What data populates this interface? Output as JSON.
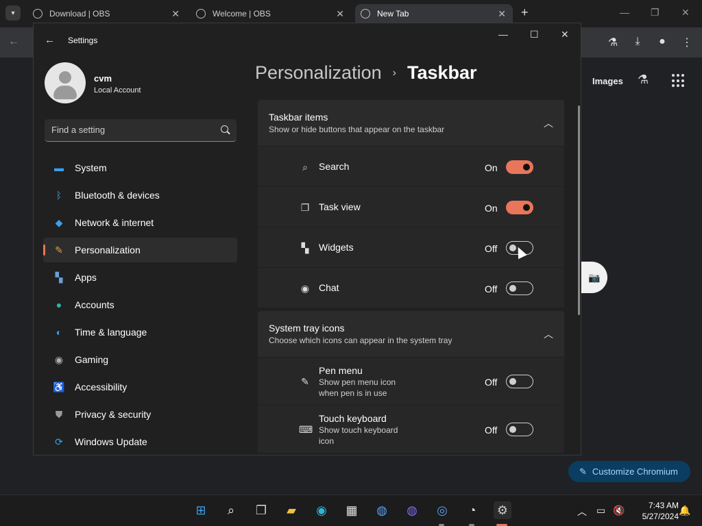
{
  "browser": {
    "tabs": [
      {
        "label": "Download | OBS",
        "active": false
      },
      {
        "label": "Welcome | OBS",
        "active": false
      },
      {
        "label": "New Tab",
        "active": true
      }
    ],
    "new_tab_page": {
      "images_label": "Images",
      "customize_label": "Customize Chromium"
    }
  },
  "settings": {
    "window_title": "Settings",
    "user": {
      "name": "cvm",
      "account_type": "Local Account"
    },
    "search": {
      "placeholder": "Find a setting"
    },
    "nav": [
      {
        "label": "System",
        "icon": "monitor-icon",
        "color": "#3aa0e8",
        "active": false
      },
      {
        "label": "Bluetooth & devices",
        "icon": "bluetooth-icon",
        "color": "#3aa0e8",
        "active": false
      },
      {
        "label": "Network & internet",
        "icon": "wifi-icon",
        "color": "#3aa0e8",
        "active": false
      },
      {
        "label": "Personalization",
        "icon": "brush-icon",
        "color": "#e0a040",
        "active": true
      },
      {
        "label": "Apps",
        "icon": "apps-icon",
        "color": "#6a9fd8",
        "active": false
      },
      {
        "label": "Accounts",
        "icon": "person-icon",
        "color": "#2fb5a6",
        "active": false
      },
      {
        "label": "Time & language",
        "icon": "globe-clock-icon",
        "color": "#3aa0e8",
        "active": false
      },
      {
        "label": "Gaming",
        "icon": "gamepad-icon",
        "color": "#b0b0b0",
        "active": false
      },
      {
        "label": "Accessibility",
        "icon": "accessibility-icon",
        "color": "#3aa0e8",
        "active": false
      },
      {
        "label": "Privacy & security",
        "icon": "shield-icon",
        "color": "#9a9a9a",
        "active": false
      },
      {
        "label": "Windows Update",
        "icon": "update-icon",
        "color": "#3aa0e8",
        "active": false
      }
    ],
    "breadcrumb": {
      "parent": "Personalization",
      "separator": "›",
      "current": "Taskbar"
    },
    "sections": [
      {
        "title": "Taskbar items",
        "subtitle": "Show or hide buttons that appear on the taskbar",
        "rows": [
          {
            "label": "Search",
            "desc": "",
            "icon": "search-icon",
            "state": "On",
            "on": true
          },
          {
            "label": "Task view",
            "desc": "",
            "icon": "task-view-icon",
            "state": "On",
            "on": true
          },
          {
            "label": "Widgets",
            "desc": "",
            "icon": "widgets-icon",
            "state": "Off",
            "on": false
          },
          {
            "label": "Chat",
            "desc": "",
            "icon": "chat-icon",
            "state": "Off",
            "on": false
          }
        ]
      },
      {
        "title": "System tray icons",
        "subtitle": "Choose which icons can appear in the system tray",
        "rows": [
          {
            "label": "Pen menu",
            "desc": "Show pen menu icon when pen is in use",
            "icon": "pen-icon",
            "state": "Off",
            "on": false
          },
          {
            "label": "Touch keyboard",
            "desc": "Show touch keyboard icon",
            "icon": "keyboard-icon",
            "state": "Off",
            "on": false
          }
        ]
      }
    ]
  },
  "taskbar": {
    "time": "7:43 AM",
    "date": "5/27/2024",
    "accent": "#e8765a"
  }
}
